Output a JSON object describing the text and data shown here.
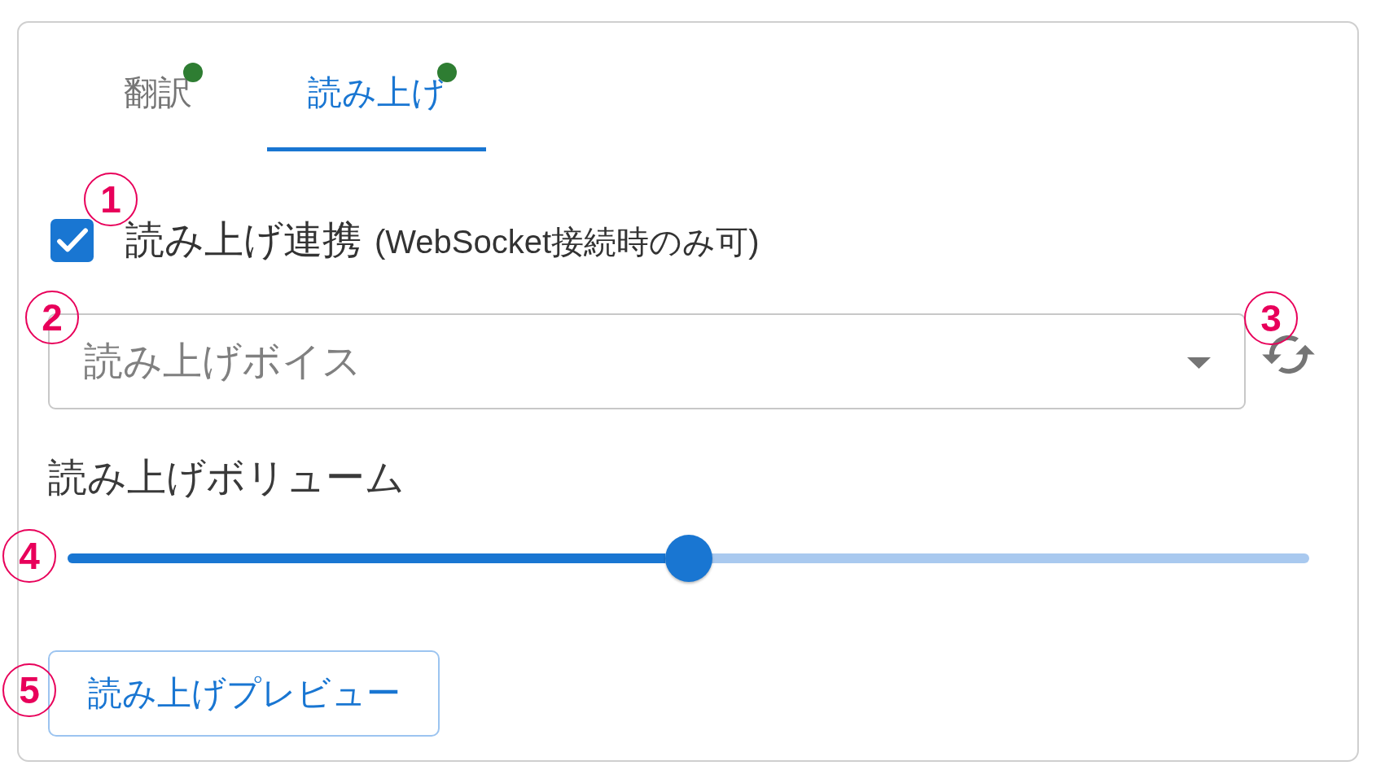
{
  "tabs": [
    {
      "label": "翻訳",
      "selected": false,
      "color": "#2e7d32"
    },
    {
      "label": "読み上げ",
      "selected": true,
      "color": "#2e7d32"
    }
  ],
  "link_checkbox": {
    "label": "読み上げ連携",
    "note": "(WebSocket接続時のみ可)",
    "checked": true,
    "callout": "1"
  },
  "voice_select": {
    "label": "読み上げボイス",
    "callout": "2"
  },
  "refresh_button": {
    "callout": "3"
  },
  "volume": {
    "label": "読み上げボリューム",
    "level": 0.5,
    "callout": "4"
  },
  "preview_button": {
    "label": "読み上げプレビュー",
    "callout": "5"
  }
}
